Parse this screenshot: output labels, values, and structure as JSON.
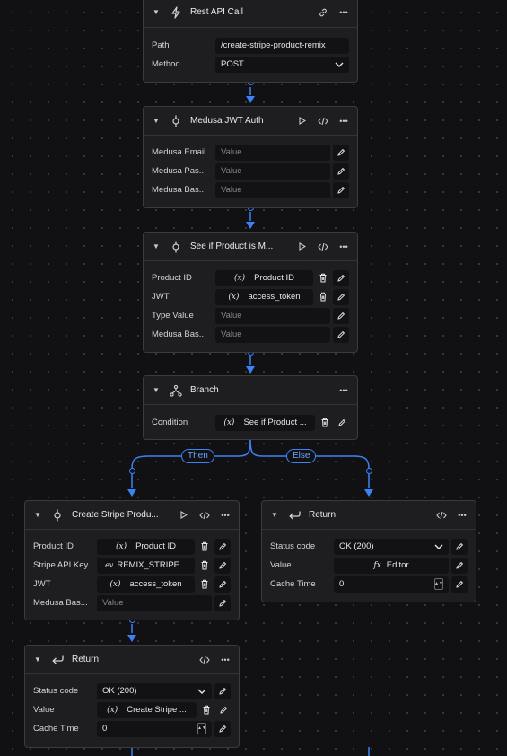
{
  "nodes": {
    "rest_api": {
      "title": "Rest API Call",
      "fields": [
        {
          "label": "Path",
          "value": "/create-stripe-product-remix"
        },
        {
          "label": "Method",
          "value": "POST"
        }
      ]
    },
    "jwt_auth": {
      "title": "Medusa JWT Auth",
      "fields": [
        {
          "label": "Medusa Email",
          "placeholder": "Value"
        },
        {
          "label": "Medusa Pas...",
          "placeholder": "Value"
        },
        {
          "label": "Medusa Bas...",
          "placeholder": "Value"
        }
      ]
    },
    "see_if": {
      "title": "See if Product is M...",
      "fields": [
        {
          "label": "Product ID",
          "value": "Product ID"
        },
        {
          "label": "JWT",
          "value": "access_token"
        },
        {
          "label": "Type Value",
          "placeholder": "Value"
        },
        {
          "label": "Medusa Bas...",
          "placeholder": "Value"
        }
      ]
    },
    "branch": {
      "title": "Branch",
      "fields": [
        {
          "label": "Condition",
          "value": "See if Product ..."
        }
      ],
      "then_label": "Then",
      "else_label": "Else"
    },
    "create_stripe": {
      "title": "Create Stripe Produ...",
      "fields": [
        {
          "label": "Product ID",
          "value": "Product ID"
        },
        {
          "label": "Stripe API Key",
          "value": "REMIX_STRIPE..."
        },
        {
          "label": "JWT",
          "value": "access_token"
        },
        {
          "label": "Medusa Bas...",
          "placeholder": "Value"
        }
      ]
    },
    "return_else": {
      "title": "Return",
      "fields": [
        {
          "label": "Status code",
          "value": "OK (200)"
        },
        {
          "label": "Value",
          "value": "Editor"
        },
        {
          "label": "Cache Time",
          "value": "0"
        }
      ]
    },
    "return_then": {
      "title": "Return",
      "fields": [
        {
          "label": "Status code",
          "value": "OK (200)"
        },
        {
          "label": "Value",
          "value": "Create Stripe ..."
        },
        {
          "label": "Cache Time",
          "value": "0"
        }
      ]
    }
  },
  "var_symbol": "(x)",
  "fx_symbol": "fx",
  "env_symbol": "e𝑣",
  "colors": {
    "canvas": "#111113",
    "node": "#1e1e21",
    "edge": "#3b82f6",
    "field": "#121214"
  }
}
